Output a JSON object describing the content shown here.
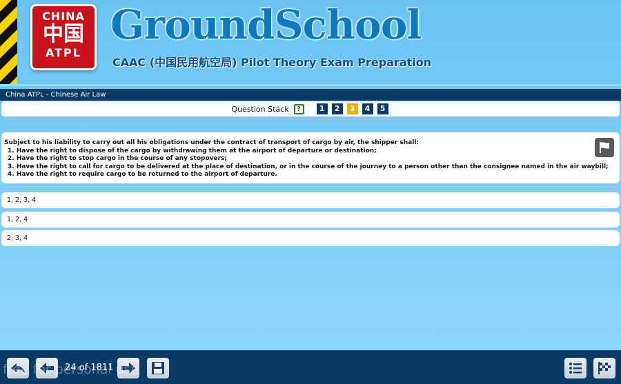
{
  "header": {
    "logo_top": "CHINA",
    "logo_middle": "中国",
    "logo_bottom": "ATPL",
    "title": "GroundSchool",
    "subtitle": "CAAC (中国民用航空局) Pilot Theory Exam Preparation"
  },
  "titlebar": {
    "text": "China ATPL - Chinese Air Law"
  },
  "question_stack": {
    "label": "Question Stack",
    "help_icon": "?",
    "items": [
      {
        "label": "1",
        "active": false
      },
      {
        "label": "2",
        "active": false
      },
      {
        "label": "3",
        "active": true
      },
      {
        "label": "4",
        "active": false
      },
      {
        "label": "5",
        "active": false
      }
    ]
  },
  "question": {
    "stem": "Subject to his liability to carry out all his obligations under the contract of transport of cargo by air, the shipper shall:",
    "items": [
      "1. Have the right to dispose of the cargo by withdrawing them at the airport of departure or destination;",
      "2. Have the right to stop cargo in the course of any stopovers;",
      "3. Have the right to call for cargo to be delivered at the place of destination, or in the course of the journey to a person other than the consignee named in the air waybill;",
      "4. Have the right to require cargo to be returned to the airport of departure."
    ],
    "flag_icon": "flag-icon"
  },
  "answers": [
    "1, 2, 3, 4",
    "1, 2, 4",
    "2, 3, 4"
  ],
  "bottombar": {
    "counter": "24 of 1811",
    "watermark": "free for personal use"
  },
  "colors": {
    "background": "#7dcdf7",
    "navy": "#0a3a66",
    "brand_blue": "#0d79bf",
    "active_stack": "#e8b100",
    "logo_red": "#c8151d"
  }
}
